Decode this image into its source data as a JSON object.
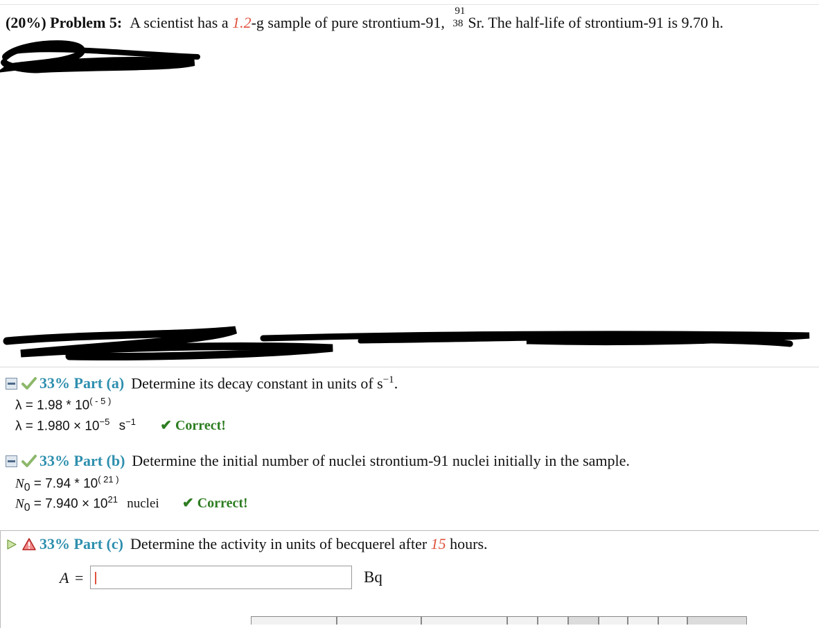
{
  "problem": {
    "percent": "(20%)",
    "label": "Problem 5:",
    "text_pre": "A scientist has a",
    "mass": "1.2",
    "text_mid": "-g sample of pure strontium-91,",
    "iso_mass": "91",
    "iso_atomic": "38",
    "iso_symbol": "Sr.",
    "text_post": "The half-life of strontium-91 is 9.70 h."
  },
  "parts": [
    {
      "percent_title": "33% Part (a)",
      "prompt": "Determine its decay constant in units of s",
      "prompt_sup": "−1",
      "prompt_end": ".",
      "entered": "λ = 1.98 * 10",
      "entered_sup": "( - 5 )",
      "result": "λ = 1.980 × 10",
      "result_sup": "−5",
      "result_unit": "s",
      "result_unit_sup": "−1",
      "feedback": "✔ Correct!"
    },
    {
      "percent_title": "33% Part (b)",
      "prompt": "Determine the initial number of nuclei strontium-91 nuclei initially in the sample.",
      "entered_var": "N",
      "entered_sub": "0",
      "entered": "= 7.94 * 10",
      "entered_sup": "( 21 )",
      "result": "= 7.940 × 10",
      "result_sup": "21",
      "result_unit": "nuclei",
      "feedback": "✔ Correct!"
    },
    {
      "percent_title": "33% Part (c)",
      "prompt_pre": "Determine the activity in units of becquerel after",
      "hours": "15",
      "prompt_post": "hours."
    }
  ],
  "answer": {
    "label": "A",
    "equals": "=",
    "value": "",
    "unit": "Bq"
  },
  "colors": {
    "accent_teal": "#2e8fae",
    "given_red": "#e0523d",
    "correct_green": "#2d7d21"
  }
}
